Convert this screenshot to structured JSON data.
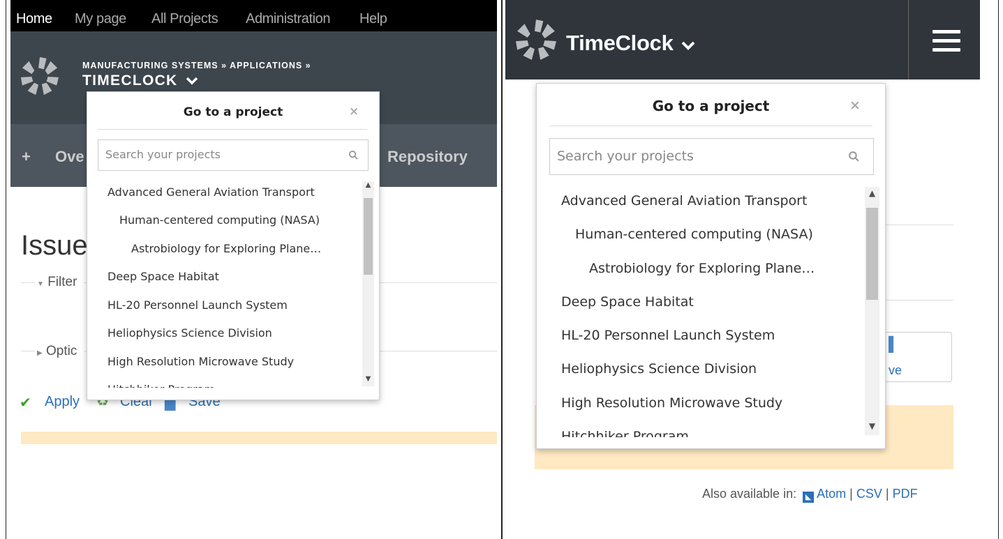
{
  "left": {
    "top_nav": [
      "Home",
      "My page",
      "All Projects",
      "Administration",
      "Help"
    ],
    "breadcrumb": "MANUFACTURING SYSTEMS » APPLICATIONS »",
    "project_title": "TIMECLOCK",
    "menu": {
      "plus": "+",
      "overview": "Ove",
      "repository": "Repository"
    },
    "page_title": "Issue",
    "filters_label": "Filter",
    "options_label": "Optic",
    "actions": {
      "apply": "Apply",
      "clear": "Clear",
      "save": "Save"
    }
  },
  "right": {
    "project_title": "TimeClock",
    "also_available": "Also available in:",
    "formats": [
      "Atom",
      "CSV",
      "PDF"
    ],
    "partial_save": "ve"
  },
  "dropdown": {
    "title": "Go to a project",
    "close": "×",
    "search_placeholder": "Search your projects",
    "projects": [
      {
        "name": "Advanced General Aviation Transport",
        "level": 0
      },
      {
        "name": "Human-centered computing (NASA)",
        "level": 1
      },
      {
        "name": "Astrobiology for Exploring Plane…",
        "level": 2
      },
      {
        "name": "Deep Space Habitat",
        "level": 0
      },
      {
        "name": "HL-20 Personnel Launch System",
        "level": 0
      },
      {
        "name": "Heliophysics Science Division",
        "level": 0
      },
      {
        "name": "High Resolution Microwave Study",
        "level": 0
      },
      {
        "name": "Hitchhiker Program",
        "level": 0
      }
    ]
  },
  "colors": {
    "header": "#3d464d",
    "link": "#2a6fb8",
    "warning_bar": "#ffe9c2"
  }
}
